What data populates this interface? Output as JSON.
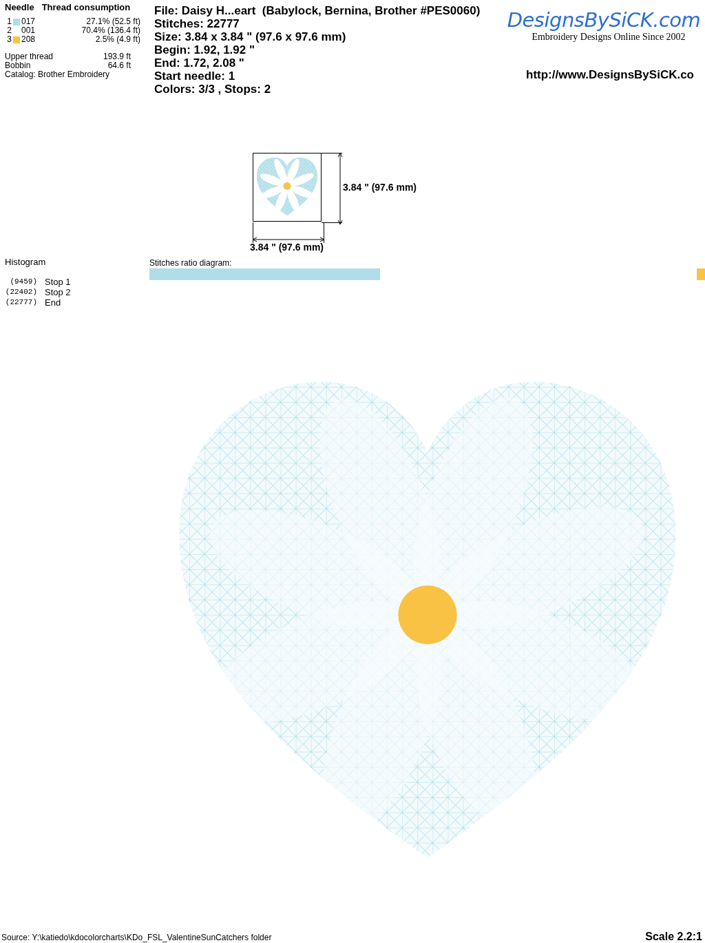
{
  "threads": {
    "headers": [
      "Needle",
      "Thread consumption"
    ],
    "rows": [
      {
        "needle": "1",
        "code": "017",
        "usage": "27.1% (52.5 ft)",
        "color": "#b0dde8"
      },
      {
        "needle": "2",
        "code": "001",
        "usage": "70.4% (136.4 ft)"
      },
      {
        "needle": "3",
        "code": "208",
        "usage": "2.5% (4.9 ft)",
        "color": "#f9c244"
      }
    ]
  },
  "totals": [
    {
      "label": "Upper thread",
      "value": "193.9 ft"
    },
    {
      "label": "Bobbin",
      "value": "64.6 ft"
    }
  ],
  "catalog": "Catalog: Brother Embroidery",
  "info": [
    "File: Daisy H...eart  (Babylock, Bernina, Brother #PES0060)",
    "Stitches: 22777",
    "Size: 3.84 x 3.84 \" (97.6 x 97.6 mm)",
    "Begin: 1.92, 1.92 \"",
    "End: 1.72, 2.08 \"",
    "Start needle: 1",
    "Colors: 3/3 , Stops: 2"
  ],
  "logo": {
    "name": "DesignsBySiCK.com",
    "tagline": "Embroidery Designs Online Since 2002"
  },
  "url": "http://www.DesignsBySiCK.co",
  "dimensions": {
    "height": "3.84 \" (97.6 mm)",
    "width": "3.84 \" (97.6 mm)"
  },
  "histogram": {
    "title": "Histogram",
    "stops": [
      {
        "count": "(9459)",
        "label": "Stop 1"
      },
      {
        "count": "(22402)",
        "label": "Stop 2"
      },
      {
        "count": "(22777)",
        "label": "End"
      }
    ]
  },
  "ratio": {
    "title": "Stitches ratio diagram:",
    "segments": [
      {
        "color": "#b0dde8",
        "level": 0.415
      },
      {
        "color": "#f9c244",
        "level": 0.015
      }
    ]
  },
  "footer": {
    "source": "Source: Y:\\katiedo\\kdocolorcharts\\KDo_FSL_ValentineSunCatchers folder",
    "scale": "Scale 2.2:1"
  }
}
